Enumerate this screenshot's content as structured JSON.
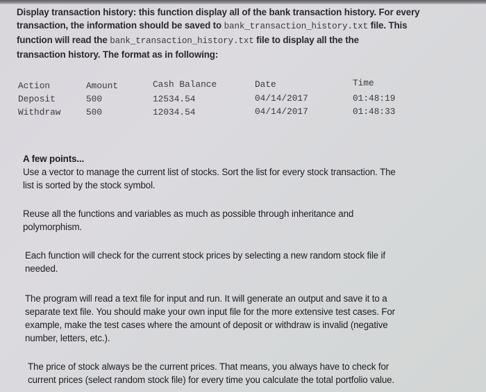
{
  "intro": {
    "label": "Display transaction history:",
    "line1_rest": " this function display all of the bank transaction history. For every",
    "line2_pre": "transaction, the information should be saved to ",
    "filename": "bank_transaction_history.txt",
    "line2_post": " file. This",
    "line3_pre": "function will read the ",
    "line3_post": "  file to display all the the",
    "line4": "transaction history. The format as in following:"
  },
  "transaction_table": {
    "headers": [
      "Action",
      "Amount",
      "Cash Balance",
      "Date",
      "Time"
    ],
    "rows": [
      [
        "Deposit",
        "500",
        "12534.54",
        "04/14/2017",
        "01:48:19"
      ],
      [
        "Withdraw",
        "500",
        "12034.54",
        "04/14/2017",
        "01:48:33"
      ]
    ]
  },
  "points": {
    "title": "A few points...",
    "paragraphs": [
      [
        "Use a vector to manage the current list of stocks. Sort the list for every stock transaction. The",
        "list is sorted by the stock symbol."
      ],
      [
        "Reuse all the functions and variables as much as possible through inheritance and",
        "polymorphism."
      ],
      [
        "Each function will check for the current stock prices by selecting a new random stock file if",
        "needed."
      ],
      [
        "The program will read a text file for input and run. It will generate an output and save it to a",
        "separate text file. You should make your own input file for the more extensive test cases. For",
        "example, make the test cases where the amount of deposit or withdraw is invalid (negative",
        "number, letters, etc.)."
      ],
      [
        "The price of stock always be the current prices. That means, you always have to check for",
        "current prices (select random stock file) for every time you calculate the total portfolio value."
      ]
    ]
  }
}
